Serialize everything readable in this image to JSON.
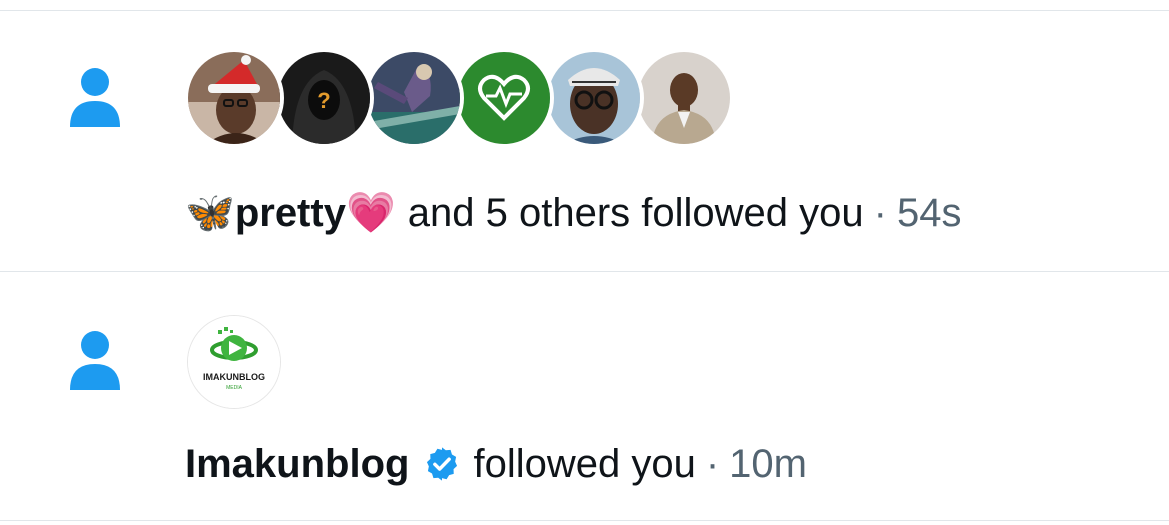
{
  "colors": {
    "accent": "#1d9bf0",
    "person_icon": "#1d9bf0",
    "text": "#0f1419",
    "muted": "#536471",
    "divider": "#e1e6ea"
  },
  "notifications": [
    {
      "icon": "person-icon",
      "avatars": [
        "avatar-pretty-santa-hat",
        "avatar-hooded-question",
        "avatar-illustrated-figure",
        "avatar-green-heart-logo",
        "avatar-man-glasses-cap",
        "avatar-man-suit"
      ],
      "name_prefix_emoji": "🦋",
      "name": "pretty",
      "name_suffix_emoji": "💗",
      "action": "and 5 others followed you",
      "separator": "·",
      "time": "54s"
    },
    {
      "icon": "person-icon",
      "avatar_logo_text": "IMAKUNBLOG",
      "avatar_logo_subtext": "MEDIA",
      "name": "Imakunblog",
      "verified": true,
      "action": "followed you",
      "separator": "·",
      "time": "10m"
    }
  ]
}
